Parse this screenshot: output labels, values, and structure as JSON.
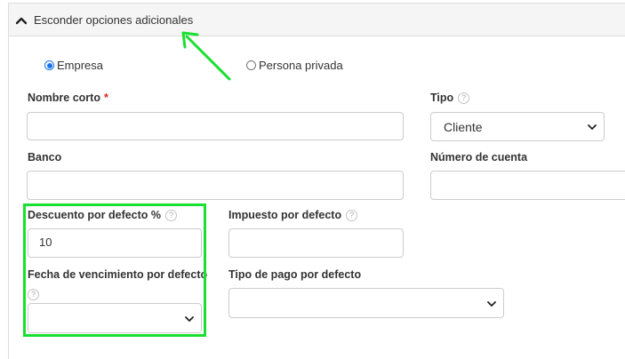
{
  "toggle": {
    "label": "Esconder opciones adicionales",
    "icon": "chevron-up-icon"
  },
  "entity_type": {
    "options": [
      {
        "label": "Empresa",
        "checked": true
      },
      {
        "label": "Persona privada",
        "checked": false
      }
    ]
  },
  "fields": {
    "nombre_corto": {
      "label": "Nombre corto",
      "required_mark": "*",
      "value": ""
    },
    "tipo": {
      "label": "Tipo",
      "help": "?",
      "selected": "Cliente"
    },
    "banco": {
      "label": "Banco",
      "value": ""
    },
    "numero_cuenta": {
      "label": "Número de cuenta",
      "value": ""
    },
    "descuento": {
      "label": "Descuento por defecto %",
      "help": "?",
      "value": "10"
    },
    "impuesto": {
      "label": "Impuesto por defecto",
      "help": "?",
      "value": ""
    },
    "fecha_vencimiento": {
      "label": "Fecha de vencimiento por defecto",
      "help": "?",
      "selected": ""
    },
    "tipo_pago": {
      "label": "Tipo de pago por defecto",
      "selected": ""
    }
  },
  "annotation": {
    "highlight_color": "#18e030",
    "arrow_color": "#18e030"
  },
  "colors": {
    "accent": "#1a73e8",
    "required": "#d9261c",
    "header_bg": "#f5f5f5"
  }
}
